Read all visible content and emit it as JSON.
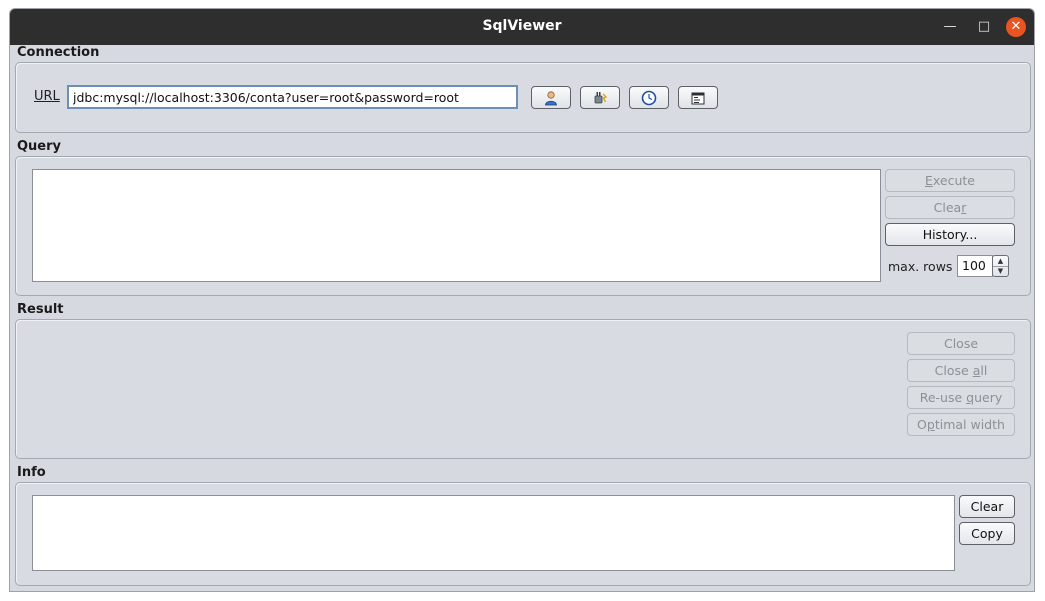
{
  "window": {
    "title": "SqlViewer"
  },
  "connection": {
    "section_label": "Connection",
    "url_label": "URL",
    "url_value": "jdbc:mysql://localhost:3306/conta?user=root&password=root",
    "icons": [
      "user-icon",
      "plug-icon",
      "clock-icon",
      "properties-icon"
    ]
  },
  "query": {
    "section_label": "Query",
    "execute": {
      "pre": "",
      "mn": "E",
      "post": "xecute"
    },
    "clear": {
      "pre": "Clea",
      "mn": "r",
      "post": ""
    },
    "history_label": "History...",
    "max_rows_label": "max. rows",
    "max_rows_value": "100"
  },
  "result": {
    "section_label": "Result",
    "close": {
      "pre": "Close",
      "mn": "",
      "post": ""
    },
    "close_all": {
      "pre": "Close ",
      "mn": "a",
      "post": "ll"
    },
    "reuse_query": {
      "pre": "Re-use ",
      "mn": "q",
      "post": "uery"
    },
    "optimal_width": {
      "pre": "O",
      "mn": "p",
      "post": "timal width"
    }
  },
  "info": {
    "section_label": "Info",
    "clear_label": "Clear",
    "copy_label": "Copy"
  },
  "colors": {
    "titlebar": "#2e2e2e",
    "close_button": "#e95420",
    "window_bg": "#d6d9df",
    "input_focus_border": "#6d8fb5"
  }
}
